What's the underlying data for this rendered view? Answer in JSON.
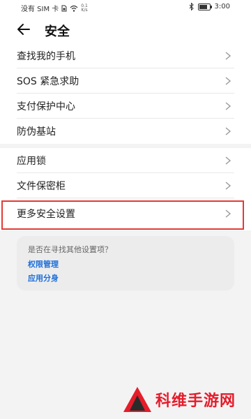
{
  "status_bar": {
    "carrier": "没有 SIM 卡",
    "speed_value": "0.1",
    "speed_unit": "K/s",
    "time": "3:00"
  },
  "header": {
    "title": "安全",
    "back_icon": "arrow-left-icon"
  },
  "section1": {
    "items": [
      {
        "label": "查找我的手机"
      },
      {
        "label": "SOS 紧急求助"
      },
      {
        "label": "支付保护中心"
      },
      {
        "label": "防伪基站"
      }
    ]
  },
  "section2": {
    "items": [
      {
        "label": "应用锁"
      },
      {
        "label": "文件保密柜"
      },
      {
        "label": "更多安全设置",
        "highlighted": true
      }
    ]
  },
  "suggestions": {
    "question": "是否在寻找其他设置项？",
    "links": [
      "权限管理",
      "应用分身"
    ]
  },
  "watermark": {
    "text": "科维手游网"
  },
  "colors": {
    "highlight_border": "#e53935",
    "link": "#1e6fd9",
    "watermark": "#e51c2b"
  }
}
